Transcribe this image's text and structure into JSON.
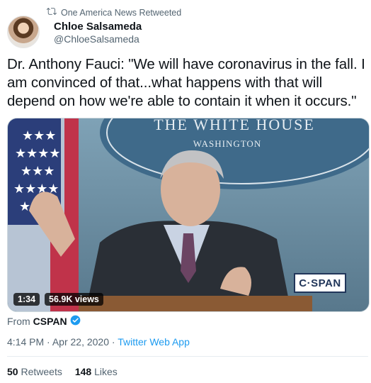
{
  "retweet": {
    "label": "One America News Retweeted"
  },
  "author": {
    "name": "Chloe Salsameda",
    "handle": "@ChloeSalsameda"
  },
  "tweet": {
    "text": "Dr. Anthony Fauci: \"We will have coronavirus in the fall. I am convinced of that...what happens with that will depend on how we're able to contain it when it occurs.\""
  },
  "video": {
    "backdrop_line1": "THE WHITE HOUSE",
    "backdrop_line2": "WASHINGTON",
    "duration": "1:34",
    "views": "56.9K views",
    "channel_logo": "C·SPAN"
  },
  "source": {
    "prefix": "From",
    "name": "CSPAN"
  },
  "meta": {
    "time": "4:14 PM",
    "date": "Apr 22, 2020",
    "separator": "·",
    "app": "Twitter Web App"
  },
  "stats": {
    "retweets_count": "50",
    "retweets_label": "Retweets",
    "likes_count": "148",
    "likes_label": "Likes"
  },
  "colors": {
    "link": "#1d9bf0",
    "muted": "#536471",
    "verified": "#1d9bf0"
  }
}
